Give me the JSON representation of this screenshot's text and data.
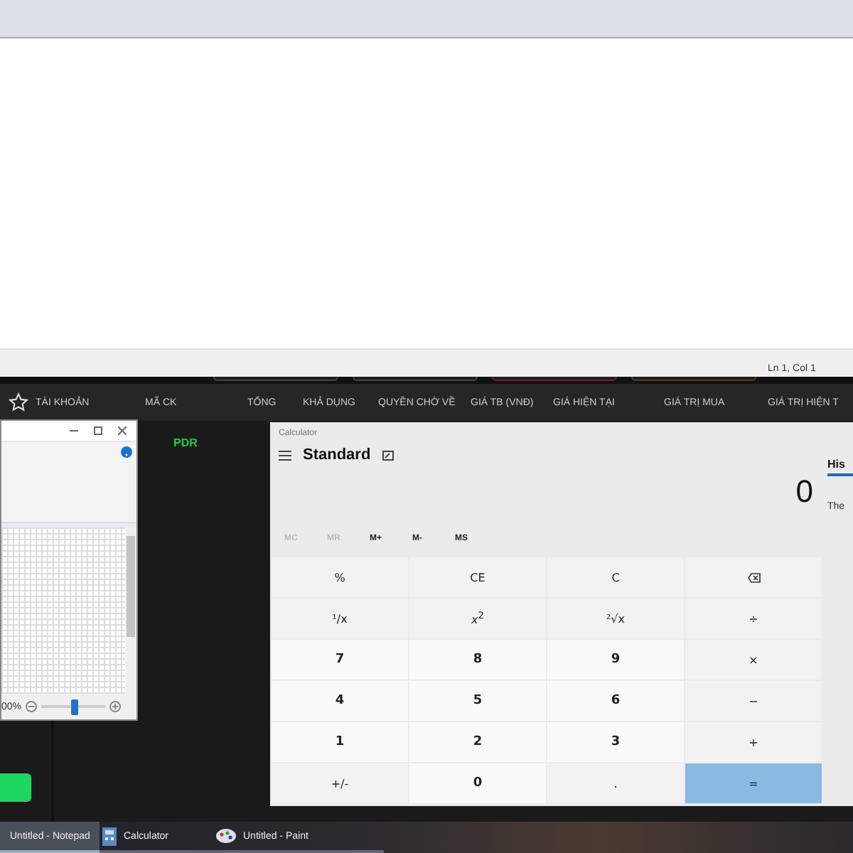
{
  "notepad": {
    "status": "Ln 1, Col 1"
  },
  "trading": {
    "columns": [
      {
        "label": "TÀI KHOẢN"
      },
      {
        "label": "MÃ CK"
      },
      {
        "label": "TỔNG"
      },
      {
        "label": "KHẢ DỤNG"
      },
      {
        "label": "QUYỀN CHỜ VỀ"
      },
      {
        "label": "GIÁ TB (VNĐ)"
      },
      {
        "label": "GIÁ HIỆN TẠI"
      },
      {
        "label": "GIÁ TRỊ MUA"
      },
      {
        "label": "GIÁ TRỊ HIỆN T"
      }
    ],
    "rows": [
      {
        "symbol": "PDR"
      }
    ]
  },
  "paint": {
    "zoom": "00%",
    "zoom_slider": {
      "level": 0.5
    }
  },
  "calculator": {
    "title": "Calculator",
    "mode": "Standard",
    "display": "0",
    "history_tab": {
      "label": "His",
      "selected": true
    },
    "history_text": "The",
    "memory": [
      {
        "label": "MC",
        "disabled": true
      },
      {
        "label": "MR",
        "disabled": true
      },
      {
        "label": "M+",
        "disabled": false
      },
      {
        "label": "M-",
        "disabled": false
      },
      {
        "label": "MS",
        "disabled": false
      }
    ],
    "keys": [
      {
        "kind": "function",
        "label": "%"
      },
      {
        "kind": "function",
        "label": "CE"
      },
      {
        "kind": "function",
        "label": "C"
      },
      {
        "kind": "backspace"
      },
      {
        "kind": "function",
        "label": "¹/x"
      },
      {
        "kind": "function",
        "label": "*x*$^{2}$"
      },
      {
        "kind": "function",
        "label": "²√x"
      },
      {
        "kind": "operator",
        "label": "÷"
      },
      {
        "kind": "digit",
        "label": "7"
      },
      {
        "kind": "digit",
        "label": "8"
      },
      {
        "kind": "digit",
        "label": "9"
      },
      {
        "kind": "operator",
        "label": "×"
      },
      {
        "kind": "digit",
        "label": "4"
      },
      {
        "kind": "digit",
        "label": "5"
      },
      {
        "kind": "digit",
        "label": "6"
      },
      {
        "kind": "operator",
        "label": "−"
      },
      {
        "kind": "digit",
        "label": "1"
      },
      {
        "kind": "digit",
        "label": "2"
      },
      {
        "kind": "digit",
        "label": "3"
      },
      {
        "kind": "operator",
        "label": "+"
      },
      {
        "kind": "function",
        "label": "+/-"
      },
      {
        "kind": "digit",
        "label": "0"
      },
      {
        "kind": "function",
        "label": "."
      },
      {
        "kind": "equals",
        "label": "="
      }
    ]
  },
  "taskbar": [
    {
      "kind": "notepad",
      "label": "Untitled - Notepad",
      "selected": true
    },
    {
      "kind": "calculator",
      "label": "Calculator",
      "selected": false
    },
    {
      "kind": "paint",
      "label": "Untitled - Paint",
      "selected": false
    }
  ]
}
